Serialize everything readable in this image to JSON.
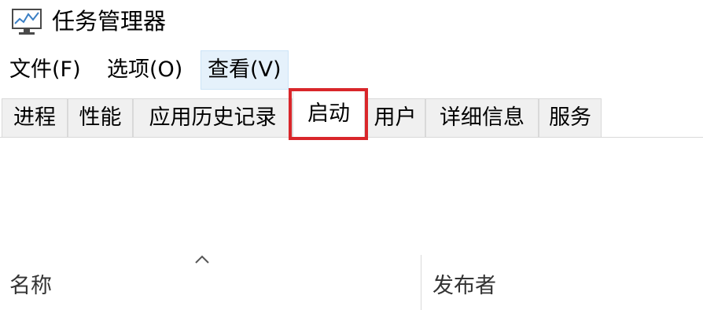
{
  "window": {
    "title": "任务管理器",
    "icon": "task-manager-icon"
  },
  "menubar": {
    "items": [
      {
        "label": "文件(F)"
      },
      {
        "label": "选项(O)"
      },
      {
        "label": "查看(V)",
        "active": true
      }
    ]
  },
  "tabs": [
    {
      "label": "进程"
    },
    {
      "label": "性能"
    },
    {
      "label": "应用历史记录"
    },
    {
      "label": "启动",
      "selected": true,
      "highlighted": true
    },
    {
      "label": "用户"
    },
    {
      "label": "详细信息"
    },
    {
      "label": "服务"
    }
  ],
  "table": {
    "columns": [
      {
        "label": "名称",
        "sorted": "ascending"
      },
      {
        "label": "发布者"
      }
    ]
  },
  "colors": {
    "highlight": "#d9262a",
    "menu_active_bg": "#e5f1fb",
    "tab_bg": "#f0f0f0",
    "border": "#d9d9d9"
  }
}
